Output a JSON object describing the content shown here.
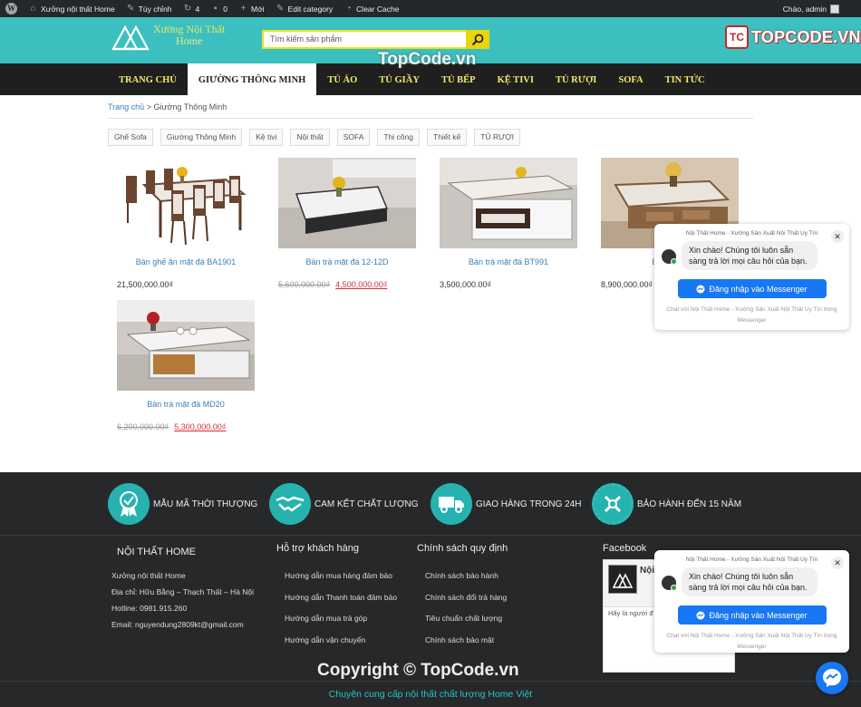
{
  "admin_bar": {
    "site_name": "Xưởng nội thất Home",
    "customize": "Tùy chỉnh",
    "updates": "4",
    "comments": "0",
    "new": "Mới",
    "edit_category": "Edit category",
    "clear_cache": "Clear Cache",
    "greeting": "Chào, admin"
  },
  "header": {
    "logo_line1": "Xưởng Nội Thất",
    "logo_line2": "Home",
    "search_placeholder": "Tìm kiếm sản phẩm",
    "brand_badge": "TC",
    "brand_text": "TOPCODE.VN"
  },
  "nav": {
    "items": [
      "TRANG CHỦ",
      "GIƯỜNG THÔNG MINH",
      "TỦ ÁO",
      "TỦ GIẦY",
      "TỦ BẾP",
      "KỆ TIVI",
      "TỦ RƯỢI",
      "SOFA",
      "TIN TỨC"
    ],
    "watermark": "TopCode.vn"
  },
  "breadcrumb": {
    "home": "Trang chủ",
    "separator": " > ",
    "current": "Giường Thông Minh"
  },
  "tags": [
    "Ghế Sofa",
    "Giường Thông Minh",
    "Kệ tivi",
    "Nội thất",
    "SOFA",
    "Thi công",
    "Thiết kế",
    "TỦ RƯỢI"
  ],
  "products": [
    {
      "name": "Bàn ghế ăn mặt đá BA1901",
      "price": "21,500,000.00₫",
      "old_price": "",
      "sale_price": ""
    },
    {
      "name": "Bàn trà mặt đá 12-12D",
      "price": "",
      "old_price": "5,600,000.00₫",
      "sale_price": "4,500,000.00₫"
    },
    {
      "name": "Bàn trà mặt đá BT991",
      "price": "3,500,000.00₫",
      "old_price": "",
      "sale_price": ""
    },
    {
      "name": "Bàn trà m",
      "price": "8,900,000.00₫",
      "old_price": "",
      "sale_price": ""
    },
    {
      "name": "Bàn trà mặt đá MD20",
      "price": "",
      "old_price": "6,200,000.00₫",
      "sale_price": "5,300,000.00₫"
    }
  ],
  "messenger": {
    "header": "Nội Thất Home - Xưởng Sản Xuất Nội Thất Uy Tín",
    "message": "Xin chào! Chúng tôi luôn sẵn sàng trả lời mọi câu hỏi của bạn.",
    "button": "Đăng nhập vào Messenger",
    "footer": "Chat với Nội Thất Home - Xưởng Sản Xuất Nội Thất Uy Tín trong Messenger",
    "close": "✕"
  },
  "features": [
    {
      "label": "MẪU MÃ THỜI THƯỢNG",
      "icon": "badge-icon"
    },
    {
      "label": "CAM KẾT CHẤT LƯỢNG",
      "icon": "handshake-icon"
    },
    {
      "label": "GIAO HÀNG TRONG 24H",
      "icon": "truck-icon"
    },
    {
      "label": "BẢO HÀNH ĐẾN 15 NĂM",
      "icon": "tools-gear-icon"
    }
  ],
  "footer": {
    "col1": {
      "title": "NỘI THẤT HOME",
      "lines": [
        "Xưởng nội thất Home",
        "Địa chỉ: Hữu Bằng – Thạch Thất – Hà Nội",
        "Hotline: 0981.915.260",
        "Email:  nguyendung2809kt@gmail.com"
      ]
    },
    "col2": {
      "title": "Hỗ trợ khách hàng",
      "links": [
        "Hướng dẫn mua hàng đảm bảo",
        "Hướng dẫn Thanh toán đảm bảo",
        "Hướng dẫn mua trả góp",
        "Hướng dẫn vận chuyển"
      ]
    },
    "col3": {
      "title": "Chính sách quy định",
      "links": [
        "Chính sách bảo hành",
        "Chính sách đổi trả hàng",
        "Tiêu chuẩn chất lượng",
        "Chính sách bảo mật"
      ]
    },
    "col4": {
      "title": "Facebook",
      "fb_name": "Nội",
      "fb_text": "Hãy là người đ của bạn thích n"
    },
    "copyright": "Copyright © TopCode.vn",
    "tagline": "Chuyên cung cấp nội thất chất lượng Home Việt"
  },
  "colors": {
    "teal": "#3cc0bf",
    "nav_bg": "#1f1f1f",
    "footer_bg": "#26282a",
    "accent_yellow": "#f3e96a",
    "messenger_blue": "#1877f2"
  }
}
